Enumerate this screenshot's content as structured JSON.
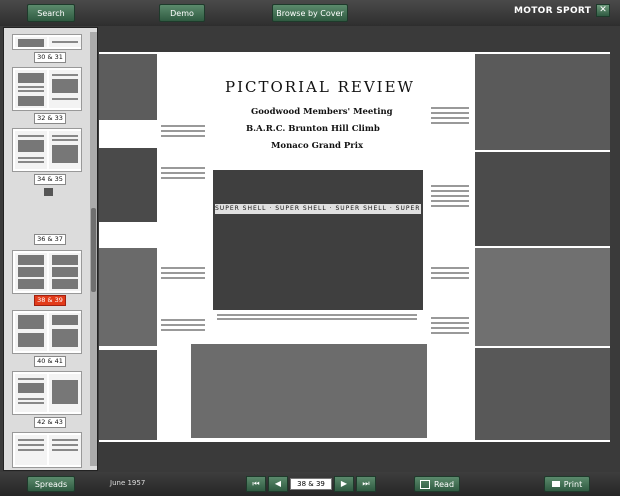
{
  "topbar": {
    "search_label": "Search",
    "demo_label": "Demo",
    "browse_label": "Browse by Cover",
    "logo_text": "MOTOR SPORT",
    "close_icon": "close-icon"
  },
  "sidebar": {
    "thumb_labels": [
      "30 & 31",
      "32 & 33",
      "34 & 35",
      "36 & 37",
      "38 & 39",
      "40 & 41",
      "42 & 43"
    ],
    "active_label": "38 & 39"
  },
  "magazine": {
    "title": "PICTORIAL REVIEW",
    "sub1": "Goodwood Members' Meeting",
    "sub2": "B.A.R.C. Brunton Hill Climb",
    "sub3": "Monaco Grand Prix",
    "banner": "SUPER SHELL"
  },
  "bottombar": {
    "spreads_label": "Spreads",
    "issue_date": "June 1957",
    "page_value": "38 & 39",
    "read_label": "Read",
    "print_label": "Print"
  },
  "colors": {
    "accent_green": "#3a6b4f",
    "active_red": "#e23b1a"
  }
}
